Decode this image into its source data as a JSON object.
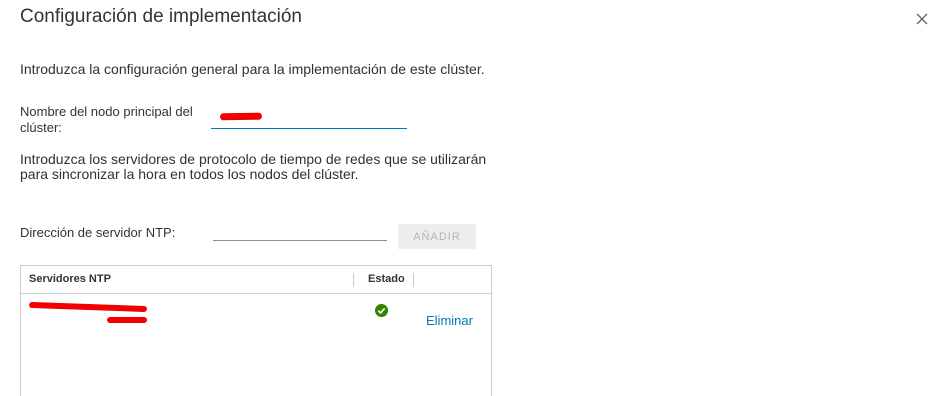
{
  "dialog": {
    "title": "Configuración de implementación",
    "intro": "Introduzca la configuración general para la implementación de este clúster.",
    "node_label": "Nombre del nodo principal del clúster:",
    "node_value": "",
    "ntp_paragraph": "Introduzca los servidores de protocolo de tiempo de redes que se utilizarán para sincronizar la hora en todos los nodos del clúster.",
    "ntp_label": "Dirección de servidor NTP:",
    "ntp_value": "",
    "add_button": "AÑADIR",
    "table": {
      "headers": [
        "Servidores NTP",
        "Estado"
      ],
      "rows": [
        {
          "server": "",
          "status_icon": "check-circle-icon",
          "action": "Eliminar"
        }
      ]
    },
    "colors": {
      "accent": "#0079b8",
      "success": "#2f8400",
      "redaction": "#f00000"
    }
  }
}
